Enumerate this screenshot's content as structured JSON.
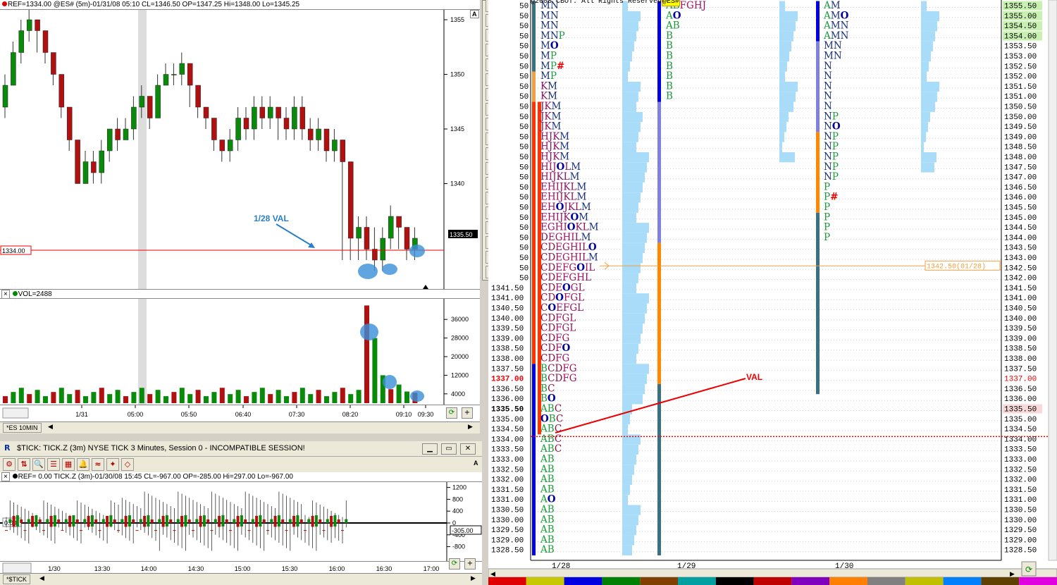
{
  "price_chart": {
    "header": "REF=1334.00 @ES# (5m)-01/31/08 05:10 CL=1346.50 OP=1347.25 Hi=1348.00 Lo=1345.25",
    "y_ticks": [
      "1355",
      "1350",
      "1345",
      "1340"
    ],
    "x_ticks": [
      "1/31",
      "05:00",
      "05:50",
      "06:40",
      "07:30",
      "08:20",
      "09:10",
      "09:30"
    ],
    "ref_label": "1334.00",
    "last_label": "1335.50",
    "annotation": "1/28 VAL",
    "corner": "A"
  },
  "volume_chart": {
    "header": "VOL=2488",
    "y_ticks": [
      "36000",
      "28000",
      "20000",
      "12000",
      "4000"
    ]
  },
  "tab_es": "*ES 10MIN",
  "tick_window": {
    "title": "$TICK: TICK.Z (3m) NYSE TICK 3 Minutes, Session 0 - INCOMPATIBLE SESSION!",
    "header": "REF= 0.00 TICK.Z (3m)-01/30/08 15:45 CL=-967.00 OP=-285.00 Hi=297.00 Lo=-967.00",
    "y_ticks": [
      "1200",
      "800",
      "400",
      "0",
      "-400",
      "-800"
    ],
    "last_label": "-305.00",
    "zero_label": "0.00",
    "x_ticks": [
      "1/30",
      "13:30",
      "14:00",
      "14:30",
      "15:00",
      "15:30",
      "16:00",
      "16:30",
      "17:00"
    ],
    "tab": "*$TICK",
    "corner": "A"
  },
  "market_profile": {
    "copyright": "@2008 CBOT. All Rights Reserved",
    "symbol_tag": "@ES#",
    "dates": [
      "1/28",
      "1/29",
      "1/30"
    ],
    "val_label": "VAL",
    "va_marker": "1342.50(01/28)",
    "prices": [
      "1355.50",
      "1355.00",
      "1354.50",
      "1354.00",
      "1353.50",
      "1353.00",
      "1352.50",
      "1352.00",
      "1351.50",
      "1351.00",
      "1350.50",
      "1350.00",
      "1349.50",
      "1349.00",
      "1348.50",
      "1348.00",
      "1347.50",
      "1347.00",
      "1346.50",
      "1346.00",
      "1345.50",
      "1345.00",
      "1344.50",
      "1344.00",
      "1343.50",
      "1343.00",
      "1342.50",
      "1342.00",
      "1341.50",
      "1341.00",
      "1340.50",
      "1340.00",
      "1339.50",
      "1339.00",
      "1338.50",
      "1338.00",
      "1337.50",
      "1337.00",
      "1336.50",
      "1336.00",
      "1335.50",
      "1335.00",
      "1334.50",
      "1334.00",
      "1333.50",
      "1333.00",
      "1332.50",
      "1332.00",
      "1331.50",
      "1331.00",
      "1330.50",
      "1330.00",
      "1329.50",
      "1329.00",
      "1328.50"
    ],
    "left_prices": [
      "1341.50",
      "1341.00",
      "1340.50",
      "1340.00",
      "1339.50",
      "1339.00",
      "1338.50",
      "1338.00",
      "1337.50",
      "1337.00",
      "1336.50",
      "1336.00",
      "1335.50",
      "1335.00",
      "1334.50",
      "1334.00",
      "1333.50",
      "1333.00",
      "1332.50",
      "1332.00",
      "1331.50",
      "1331.00",
      "1330.50",
      "1330.00",
      "1329.50",
      "1329.00",
      "1328.50"
    ],
    "left_price_stubs": [
      "50",
      "50",
      "50",
      "50",
      "50",
      "50",
      "50",
      "50",
      "50",
      "50",
      "50",
      "50",
      "50",
      "50",
      "50",
      "50",
      "50",
      "50",
      "50",
      "50",
      "50",
      "50",
      "50",
      "50",
      "50",
      "50",
      "50",
      "50"
    ],
    "profile_0128": [
      "MN",
      "MN",
      "MN",
      "MNP",
      "MO",
      "MP",
      "MP#",
      "MP",
      "KM",
      "KM",
      "JKM",
      "JKM",
      "JKM",
      "HJKM",
      "HJKM",
      "HJKM",
      "HIJOLM",
      "HIJKLM",
      "EHIJKLM",
      "EHIJKLM",
      "EHOJKLM",
      "EHIJKOM",
      "EGHIOKLM",
      "DEGHILM",
      "CDEGHILO",
      "CDEGHILM",
      "CDEFGOIL",
      "CDEFGHL",
      "CDEOGL",
      "CDOFGL",
      "COEFGL",
      "CDFGL",
      "CDFGL",
      "CDFG",
      "CDFO",
      "CDFG",
      "BCDFG",
      "BCDFG",
      "BC",
      "BO",
      "ABC",
      "OBC",
      "ABC",
      "ABC",
      "ABC",
      "AB",
      "AB",
      "AB",
      "AB",
      "AO",
      "AB",
      "AB",
      "AB",
      "AB",
      "AB"
    ],
    "profile_0129": [
      "ABFGHJ",
      "AO",
      "AB",
      "B",
      "B",
      "B",
      "B",
      "B",
      "B",
      "B"
    ],
    "profile_0130": [
      "AM",
      "AMO",
      "AMN",
      "AMN",
      "MN",
      "MN",
      "N",
      "N",
      "N",
      "N",
      "N",
      "NP",
      "NO",
      "NP",
      "NP",
      "NP",
      "NP",
      "NP",
      "P",
      "P#",
      "P",
      "P",
      "P",
      "P"
    ]
  },
  "palette": [
    "#e00000",
    "#c8c800",
    "#0000e0",
    "#008000",
    "#804000",
    "#00a0a0",
    "#000000",
    "#c00000",
    "#8000c0",
    "#ff8000",
    "#808080",
    "#c0c000",
    "#0080ff",
    "#604000",
    "#e000e0"
  ]
}
